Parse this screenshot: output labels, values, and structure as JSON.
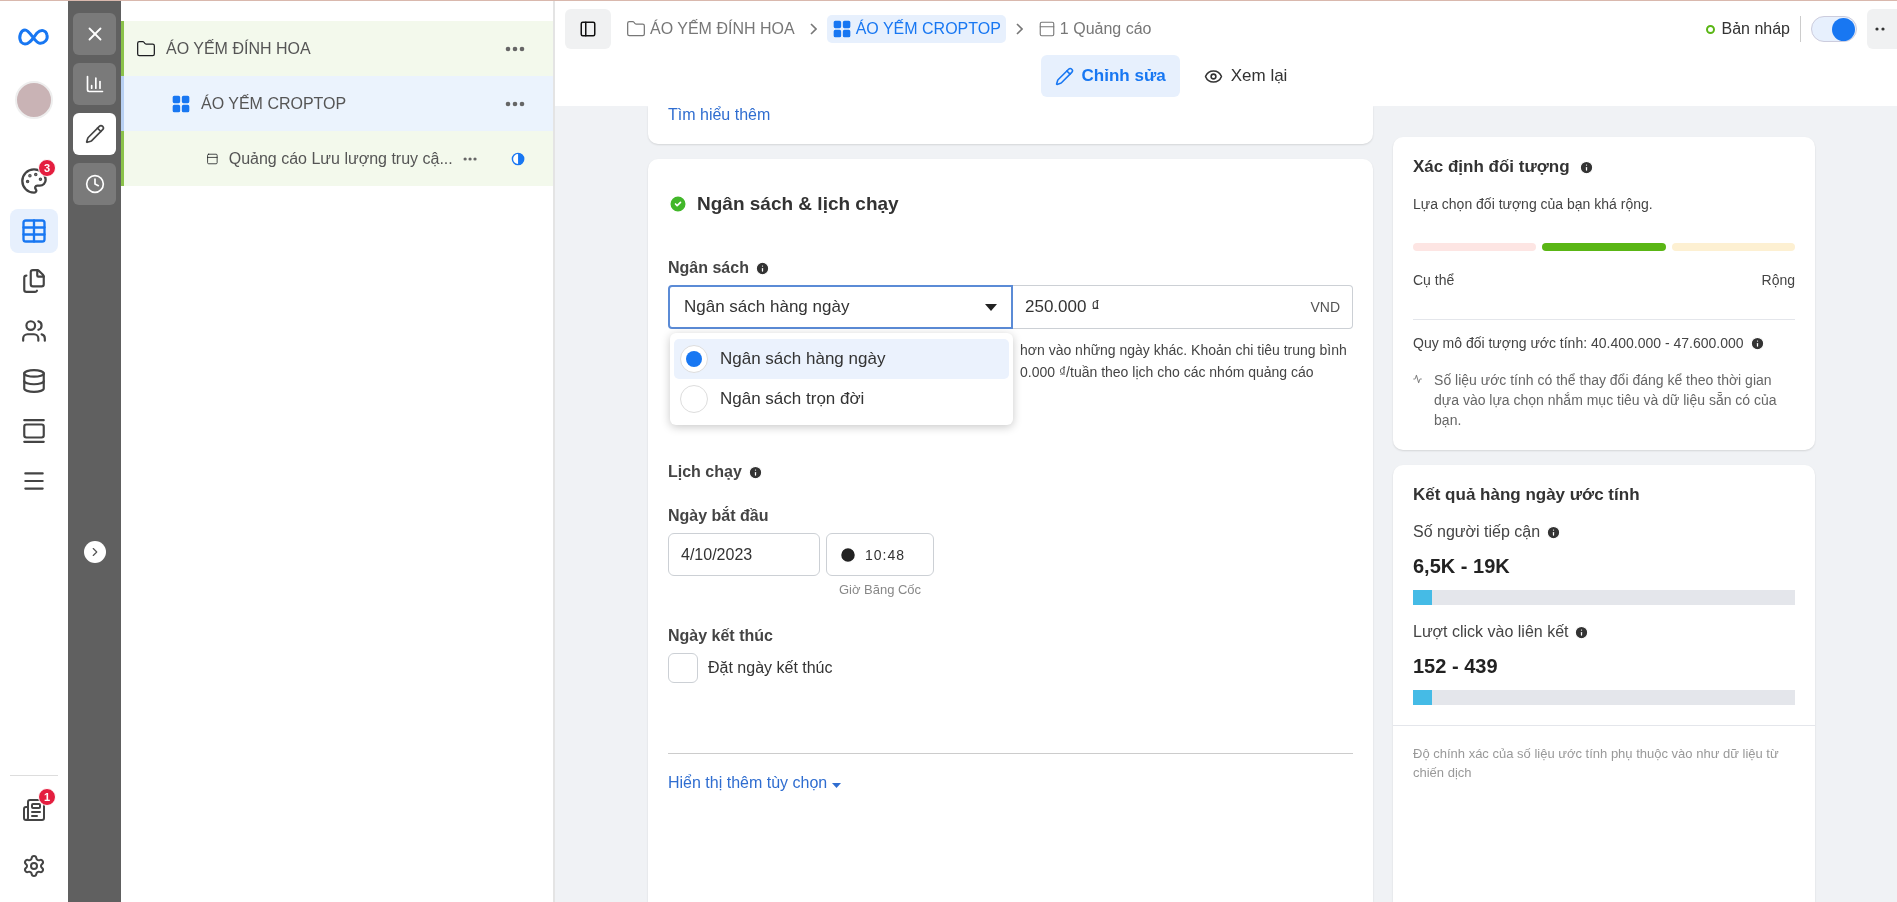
{
  "nav": {
    "items": [
      {
        "kind": "avatar",
        "selected": false
      },
      {
        "kind": "palette",
        "badge": "3",
        "selected": false
      },
      {
        "kind": "table",
        "selected": true
      },
      {
        "kind": "pages",
        "selected": false
      },
      {
        "kind": "people",
        "selected": false
      },
      {
        "kind": "coins",
        "selected": false
      },
      {
        "kind": "media",
        "selected": false
      },
      {
        "kind": "menu",
        "selected": false
      }
    ],
    "bottom": [
      {
        "kind": "news",
        "badge": "1"
      },
      {
        "kind": "settings"
      }
    ]
  },
  "tools": [
    {
      "kind": "close",
      "selected": false
    },
    {
      "kind": "chart",
      "selected": false
    },
    {
      "kind": "edit",
      "selected": true
    },
    {
      "kind": "history",
      "selected": false
    }
  ],
  "tree": [
    {
      "kind": "campaign",
      "label": "ÁO YẾM ĐÍNH HOA",
      "selected": false,
      "children": [
        {
          "kind": "adset",
          "label": "ÁO YẾM CROPTOP",
          "selected": true,
          "children": [
            {
              "kind": "ad",
              "label": "Quảng cáo Lưu lượng truy cậ...",
              "selected": false
            }
          ]
        }
      ]
    }
  ],
  "breadcrumb": [
    {
      "kind": "campaign",
      "label": "ÁO YẾM ĐÍNH HOA",
      "selected": false
    },
    {
      "kind": "adset",
      "label": "ÁO YẾM CROPTOP",
      "selected": true
    },
    {
      "kind": "ad",
      "label": "1 Quảng cáo",
      "selected": false
    }
  ],
  "status": {
    "label": "Bản nháp",
    "color": "#5ab615"
  },
  "toggle": {
    "on": true
  },
  "modes": [
    {
      "kind": "edit",
      "label": "Chỉnh sửa",
      "selected": true
    },
    {
      "kind": "review",
      "label": "Xem lại",
      "selected": false
    }
  ],
  "intro_card": {
    "link": "Tìm hiểu thêm"
  },
  "budget_card": {
    "title": "Ngân sách & lịch chạy",
    "complete": true,
    "budget_label": "Ngân sách",
    "budget_type": "Ngân sách hàng ngày",
    "expanded": true,
    "options": [
      {
        "label": "Ngân sách hàng ngày",
        "selected": true
      },
      {
        "label": "Ngân sách trọn đời",
        "selected": false
      }
    ],
    "amount": "250.000 ₫",
    "currency": "VND",
    "help_lines": [
      "hơn vào những ngày khác. Khoản chi tiêu trung bình",
      "0.000 ₫/tuần theo lịch cho các nhóm quảng cáo"
    ],
    "schedule_label": "Lịch chạy",
    "start_label": "Ngày bắt đầu",
    "start_date": "4/10/2023",
    "start_time": "10:48",
    "timezone": "Giờ Băng Cốc",
    "end_label": "Ngày kết thúc",
    "end_checkbox": {
      "label": "Đặt ngày kết thúc",
      "checked": false
    },
    "more_link": "Hiển thị thêm tùy chọn"
  },
  "audience_card": {
    "title": "Xác định đối tượng",
    "summary": "Lựa chọn đối tượng của bạn khá rộng.",
    "segments": [
      {
        "color": "#fde5e3"
      },
      {
        "color": "#5ab615"
      },
      {
        "color": "#fdf0d2"
      }
    ],
    "left_label": "Cụ thể",
    "right_label": "Rộng",
    "size": "Quy mô đối tượng ước tính: 40.400.000 - 47.600.000",
    "note": "Số liệu ước tính có thể thay đổi đáng kể theo thời gian dựa vào lựa chọn nhắm mục tiêu và dữ liệu sẵn có của bạn."
  },
  "results_card": {
    "title": "Kết quả hàng ngày ước tính",
    "metrics": [
      {
        "label": "Số người tiếp cận",
        "value": "6,5K - 19K",
        "level": 0.05
      },
      {
        "label": "Lượt click vào liên kết",
        "value": "152 - 439",
        "level": 0.05
      }
    ],
    "footer": "Độ chính xác của số liệu ước tính phụ thuộc vào như dữ liệu từ chiến dịch"
  }
}
